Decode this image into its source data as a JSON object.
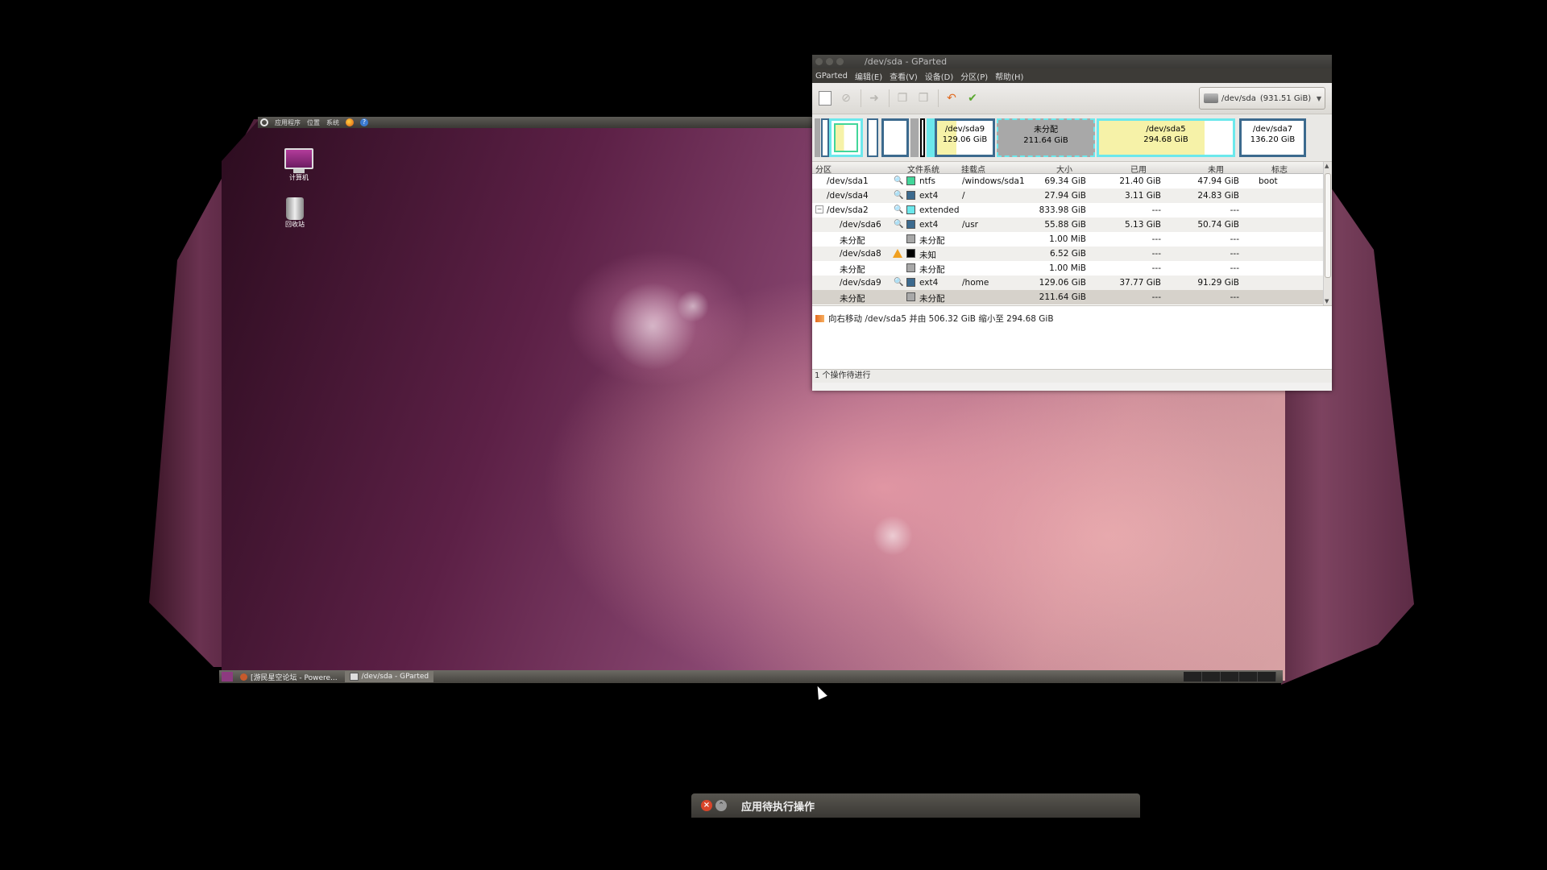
{
  "top_panel": {
    "applications": "应用程序",
    "places": "位置",
    "system": "系统"
  },
  "desktop_icons": [
    {
      "label": "计算机",
      "icon": "computer-icon"
    },
    {
      "label": "回收站",
      "icon": "trash-icon"
    }
  ],
  "taskbar": {
    "items": [
      {
        "label": "[游民星空论坛 - Powere...",
        "icon": "browser-icon"
      },
      {
        "label": "/dev/sda - GParted",
        "icon": "gparted-icon"
      }
    ]
  },
  "gparted": {
    "title": "/dev/sda - GParted",
    "menu": [
      "GParted",
      "编辑(E)",
      "查看(V)",
      "设备(D)",
      "分区(P)",
      "帮助(H)"
    ],
    "device": {
      "name": "/dev/sda",
      "size": "(931.51 GiB)"
    },
    "partition_map": [
      {
        "name": "/dev/sda9",
        "size": "129.06 GiB"
      },
      {
        "name": "未分配",
        "size": "211.64 GiB"
      },
      {
        "name": "/dev/sda5",
        "size": "294.68 GiB"
      },
      {
        "name": "/dev/sda7",
        "size": "136.20 GiB"
      }
    ],
    "columns": [
      "分区",
      "文件系统",
      "挂载点",
      "大小",
      "已用",
      "未用",
      "标志"
    ],
    "rows": [
      {
        "partition": "/dev/sda1",
        "fs": "ntfs",
        "fs_color": "#42d69a",
        "mount": "/windows/sda1",
        "size": "69.34 GiB",
        "used": "21.40 GiB",
        "unused": "47.94 GiB",
        "flags": "boot",
        "icon": "key"
      },
      {
        "partition": "/dev/sda4",
        "fs": "ext4",
        "fs_color": "#3c6a8e",
        "mount": "/",
        "size": "27.94 GiB",
        "used": "3.11 GiB",
        "unused": "24.83 GiB",
        "flags": "",
        "icon": "key"
      },
      {
        "partition": "/dev/sda2",
        "fs": "extended",
        "fs_color": "#6ce8ec",
        "mount": "",
        "size": "833.98 GiB",
        "used": "---",
        "unused": "---",
        "flags": "",
        "icon": "key"
      },
      {
        "partition": "/dev/sda6",
        "fs": "ext4",
        "fs_color": "#3c6a8e",
        "mount": "/usr",
        "size": "55.88 GiB",
        "used": "5.13 GiB",
        "unused": "50.74 GiB",
        "flags": "",
        "icon": "key"
      },
      {
        "partition": "未分配",
        "fs": "未分配",
        "fs_color": "#a8a8a8",
        "mount": "",
        "size": "1.00 MiB",
        "used": "---",
        "unused": "---",
        "flags": "",
        "icon": ""
      },
      {
        "partition": "/dev/sda8",
        "fs": "未知",
        "fs_color": "#000000",
        "mount": "",
        "size": "6.52 GiB",
        "used": "---",
        "unused": "---",
        "flags": "",
        "icon": "warning"
      },
      {
        "partition": "未分配",
        "fs": "未分配",
        "fs_color": "#a8a8a8",
        "mount": "",
        "size": "1.00 MiB",
        "used": "---",
        "unused": "---",
        "flags": "",
        "icon": ""
      },
      {
        "partition": "/dev/sda9",
        "fs": "ext4",
        "fs_color": "#3c6a8e",
        "mount": "/home",
        "size": "129.06 GiB",
        "used": "37.77 GiB",
        "unused": "91.29 GiB",
        "flags": "",
        "icon": "key"
      },
      {
        "partition": "未分配",
        "fs": "未分配",
        "fs_color": "#a8a8a8",
        "mount": "",
        "size": "211.64 GiB",
        "used": "---",
        "unused": "---",
        "flags": "",
        "icon": ""
      }
    ],
    "pending_operation": "向右移动 /dev/sda5 并由 506.32 GiB 缩小至 294.68 GiB",
    "status": "1 个操作待进行"
  },
  "pending_dialog": {
    "title": "应用待执行操作"
  }
}
